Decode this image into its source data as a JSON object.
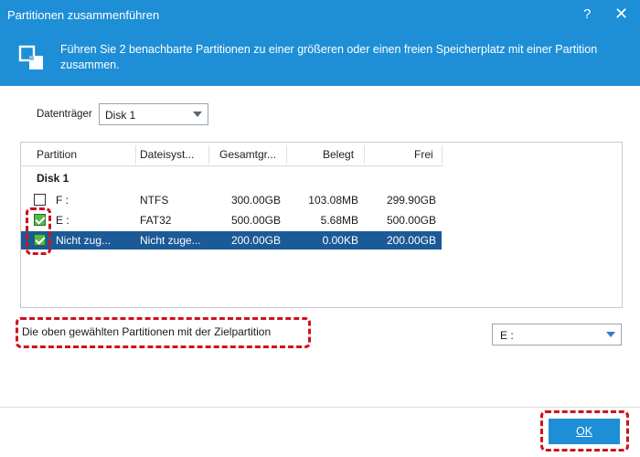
{
  "window": {
    "title": "Partitionen zusammenführen",
    "help_label": "?",
    "close_label": "✕"
  },
  "banner": {
    "text": "Führen Sie 2 benachbarte Partitionen zu einer größeren oder einen freien Speicherplatz mit einer Partition zusammen.",
    "icon": "merge-icon"
  },
  "disk_selector": {
    "label": "Datenträger",
    "value": "Disk 1"
  },
  "table": {
    "headers": [
      "Partition",
      "Dateisyst...",
      "Gesamtgr...",
      "Belegt",
      "Frei"
    ],
    "group_label": "Disk 1",
    "rows": [
      {
        "checked": false,
        "partition": "F :",
        "filesystem": "NTFS",
        "total": "300.00GB",
        "used": "103.08MB",
        "free": "299.90GB",
        "selected": false
      },
      {
        "checked": true,
        "partition": "E :",
        "filesystem": "FAT32",
        "total": "500.00GB",
        "used": "5.68MB",
        "free": "500.00GB",
        "selected": false
      },
      {
        "checked": true,
        "partition": "Nicht zug...",
        "filesystem": "Nicht zuge...",
        "total": "200.00GB",
        "used": "0.00KB",
        "free": "200.00GB",
        "selected": true
      }
    ]
  },
  "target": {
    "label": "Die oben gewählten Partitionen mit der Zielpartition",
    "value": "E :"
  },
  "footer": {
    "ok_label": "OK"
  },
  "colors": {
    "accent": "#1e8fd6",
    "selected_row": "#1b5a96",
    "highlight": "#d0101e",
    "check_green": "#56b84a"
  }
}
